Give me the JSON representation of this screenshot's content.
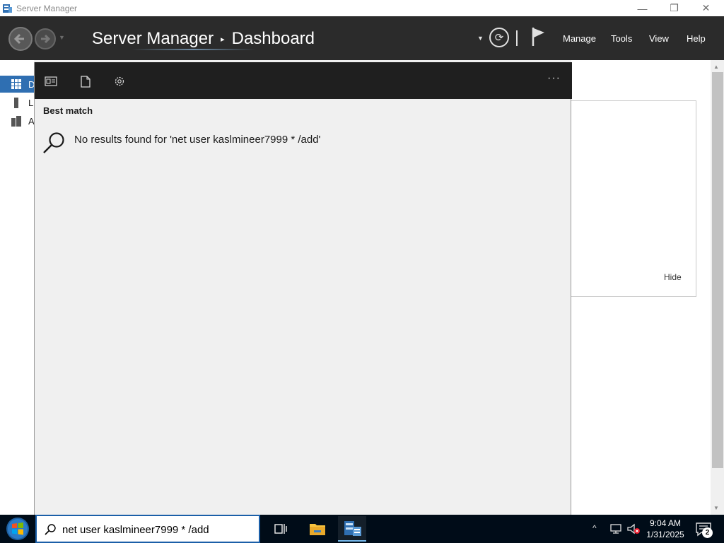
{
  "window": {
    "title": "Server Manager",
    "minimize_glyph": "—",
    "maximize_glyph": "❐",
    "close_glyph": "✕"
  },
  "header": {
    "breadcrumb_root": "Server Manager",
    "breadcrumb_arrow": "▸",
    "breadcrumb_current": "Dashboard",
    "menus": {
      "manage": "Manage",
      "tools": "Tools",
      "view": "View",
      "help": "Help"
    },
    "refresh_glyph": "⟳",
    "dropdown_glyph": "▼"
  },
  "sidebar": {
    "items": [
      {
        "letter": "D",
        "icon": "dashboard-grid-icon"
      },
      {
        "letter": "L",
        "icon": "server-icon"
      },
      {
        "letter": "A",
        "icon": "servers-group-icon"
      }
    ]
  },
  "welcome": {
    "hide_label": "Hide"
  },
  "search_panel": {
    "more_label": "···",
    "best_match_label": "Best match",
    "no_results_text": "No results found for 'net user kaslmineer7999 * /add'"
  },
  "taskbar": {
    "search_value": "net user kaslmineer7999 * /add",
    "time": "9:04 AM",
    "date": "1/31/2025",
    "notification_count": "2",
    "tray_up_glyph": "^"
  },
  "colors": {
    "header_bg": "#2b2b2b",
    "panel_top_bg": "#1f1f1f",
    "taskbar_bg": "#000c18",
    "accent": "#2f6fb2"
  }
}
